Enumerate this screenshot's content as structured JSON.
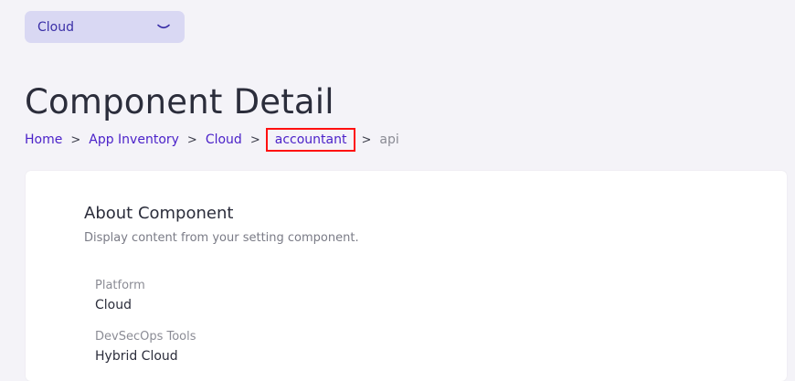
{
  "platform_selector": {
    "value": "Cloud",
    "icon": "chevron-down-icon"
  },
  "page": {
    "title": "Component Detail"
  },
  "breadcrumb": {
    "items": [
      {
        "label": "Home"
      },
      {
        "label": "App Inventory"
      },
      {
        "label": "Cloud"
      },
      {
        "label": "accountant"
      },
      {
        "label": "api"
      }
    ],
    "separator": ">"
  },
  "about": {
    "title": "About Component",
    "description": "Display content from your setting component.",
    "fields": [
      {
        "label": "Platform",
        "value": "Cloud"
      },
      {
        "label": "DevSecOps Tools",
        "value": "Hybrid Cloud"
      }
    ]
  },
  "colors": {
    "accent": "#4b22c9",
    "select_bg": "#d9d8f3",
    "highlight": "#ff1010"
  }
}
